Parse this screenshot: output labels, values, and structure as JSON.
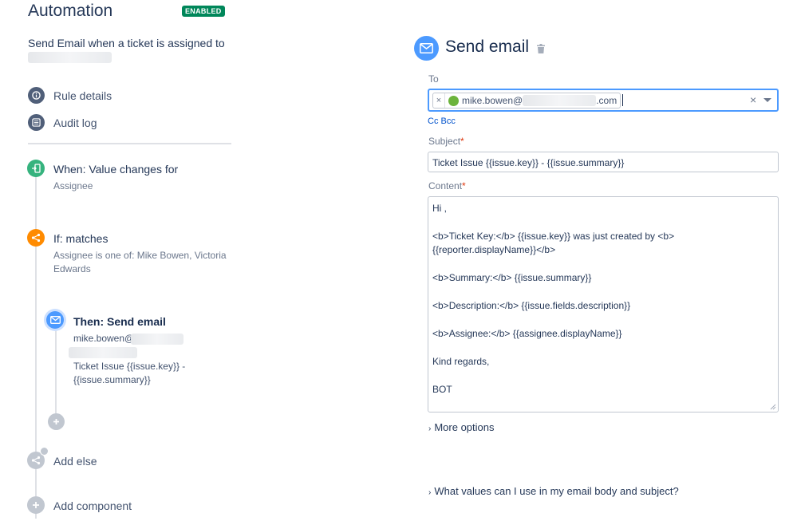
{
  "header": {
    "title": "Automation",
    "status_badge": "ENABLED"
  },
  "rule": {
    "name": "Send Email when a ticket is assigned to"
  },
  "nav": [
    {
      "label": "Rule details",
      "icon": "info-icon"
    },
    {
      "label": "Audit log",
      "icon": "list-icon"
    }
  ],
  "flow": {
    "trigger": {
      "title": "When: Value changes for",
      "subtitle": "Assignee",
      "icon": "trigger-icon",
      "color": "#36b37e"
    },
    "condition": {
      "title": "If: matches",
      "subtitle_line1": "Assignee is one of: Mike Bowen, Victoria",
      "subtitle_line2": "Edwards",
      "icon": "branch-icon",
      "color": "#ff8b00"
    },
    "action": {
      "title": "Then: Send email",
      "to": "mike.bowen@",
      "subject_line1": "Ticket Issue {{issue.key}} -",
      "subject_line2": "{{issue.summary}}",
      "icon": "email-icon",
      "color": "#4c9aff"
    },
    "add_else": "Add else",
    "add_component": "Add component"
  },
  "editor": {
    "title": "Send email",
    "to_label": "To",
    "to_recipient_prefix": "mike.bowen@",
    "to_recipient_suffix": ".com",
    "chip_remove": "×",
    "clear_glyph": "×",
    "cc_bcc": "Cc Bcc",
    "subject_label": "Subject",
    "subject_value": "Ticket Issue {{issue.key}} - {{issue.summary}}",
    "content_label": "Content",
    "required_mark": "*",
    "content_lines": [
      "Hi ,",
      "<b>Ticket Key:</b> {{issue.key}} was just created by <b>",
      "{{reporter.displayName}}</b>",
      "<b>Summary:</b> {{issue.summary}}",
      "<b>Description:</b> {{issue.fields.description}}",
      "<b>Assignee:</b> {{assignee.displayName}}",
      "Kind regards,",
      "BOT"
    ],
    "more_options": "More options",
    "help_link": "What values can I use in my email body and subject?"
  },
  "colors": {
    "accent": "#4c9aff",
    "enabled": "#00875a",
    "link": "#0052cc"
  }
}
